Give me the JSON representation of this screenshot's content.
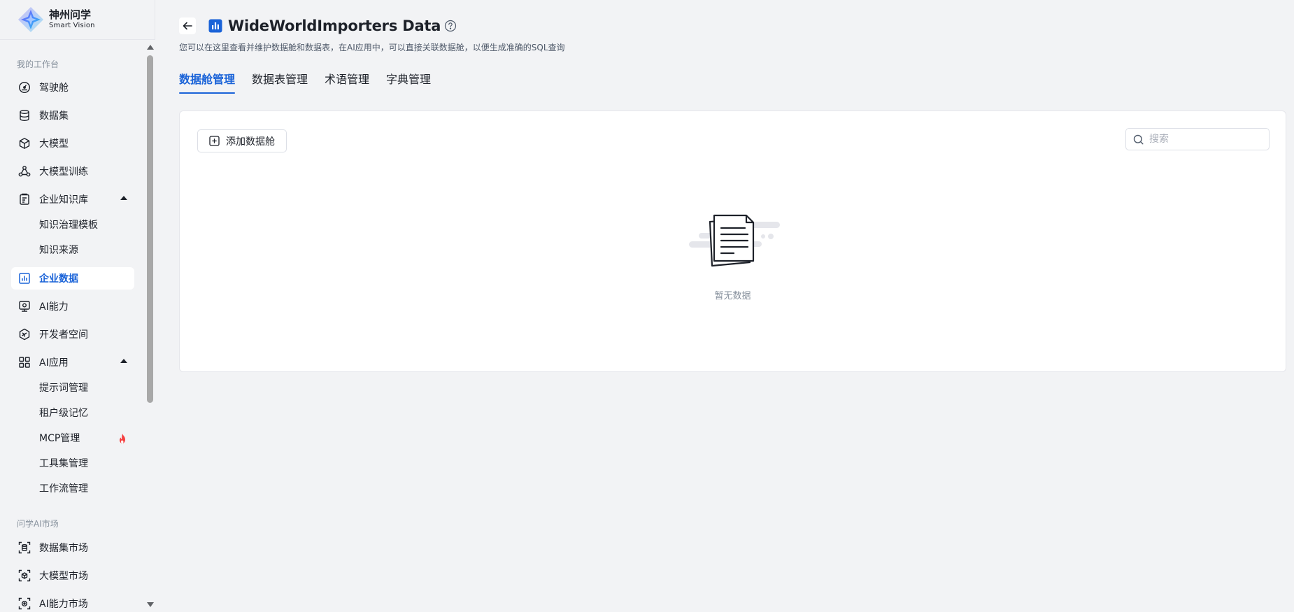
{
  "brand": {
    "name": "神州问学",
    "sub": "Smart Vision"
  },
  "sidebar": {
    "section1_title": "我的工作台",
    "items": [
      {
        "label": "驾驶舱",
        "icon": "dashboard-icon"
      },
      {
        "label": "数据集",
        "icon": "database-icon"
      },
      {
        "label": "大模型",
        "icon": "cube-icon"
      },
      {
        "label": "大模型训练",
        "icon": "training-icon"
      },
      {
        "label": "企业知识库",
        "icon": "knowledge-icon"
      },
      {
        "label": "企业数据",
        "icon": "chart-icon"
      },
      {
        "label": "AI能力",
        "icon": "ai-capability-icon"
      },
      {
        "label": "开发者空间",
        "icon": "developer-icon"
      },
      {
        "label": "AI应用",
        "icon": "apps-grid-icon"
      }
    ],
    "knowledge_sub": [
      "知识治理模板",
      "知识来源"
    ],
    "ai_app_sub": [
      "提示词管理",
      "租户级记忆",
      "MCP管理",
      "工具集管理",
      "工作流管理"
    ],
    "section2_title": "问学AI市场",
    "market_items": [
      {
        "label": "数据集市场",
        "icon": "dataset-market-icon"
      },
      {
        "label": "大模型市场",
        "icon": "model-market-icon"
      },
      {
        "label": "AI能力市场",
        "icon": "ai-market-icon"
      }
    ]
  },
  "page": {
    "title": "WideWorldImporters Data",
    "subtitle": "您可以在这里查看并维护数据舱和数据表，在AI应用中，可以直接关联数据舱，以便生成准确的SQL查询",
    "tabs": [
      "数据舱管理",
      "数据表管理",
      "术语管理",
      "字典管理"
    ],
    "active_tab": "数据舱管理"
  },
  "toolbar": {
    "add_label": "添加数据舱",
    "search_placeholder": "搜索"
  },
  "empty": {
    "text": "暂无数据"
  },
  "colors": {
    "accent": "#1a63d8",
    "background": "#f2f3f5",
    "hot": "#f53f3f"
  }
}
